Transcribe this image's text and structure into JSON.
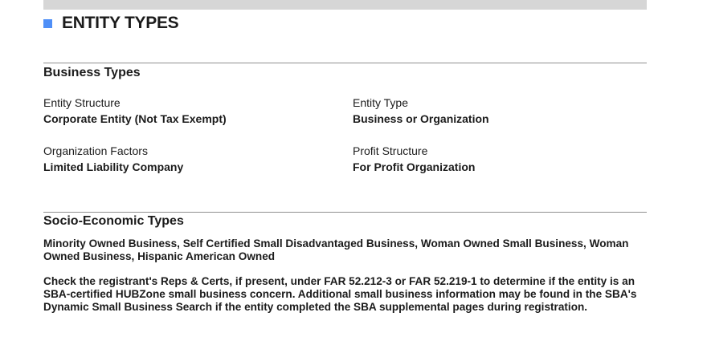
{
  "header": {
    "title": "ENTITY TYPES",
    "accent_color": "#4f8ff7",
    "icon": "square-icon"
  },
  "business_types": {
    "heading": "Business Types",
    "fields": [
      {
        "label": "Entity Structure",
        "value": "Corporate Entity (Not Tax Exempt)"
      },
      {
        "label": "Entity Type",
        "value": "Business or Organization"
      },
      {
        "label": "Organization Factors",
        "value": "Limited Liability Company"
      },
      {
        "label": "Profit Structure",
        "value": "For Profit Organization"
      }
    ]
  },
  "socio_economic": {
    "heading": "Socio-Economic Types",
    "types_text": "Minority Owned Business, Self Certified Small Disadvantaged Business, Woman Owned Small Business, Woman Owned Business, Hispanic American Owned",
    "note_text": "Check the registrant's Reps & Certs, if present, under FAR 52.212-3 or FAR 52.219-1 to determine if the entity is an SBA-certified HUBZone small business concern. Additional small business information may be found in the SBA's Dynamic Small Business Search if the entity completed the SBA supplemental pages during registration."
  }
}
